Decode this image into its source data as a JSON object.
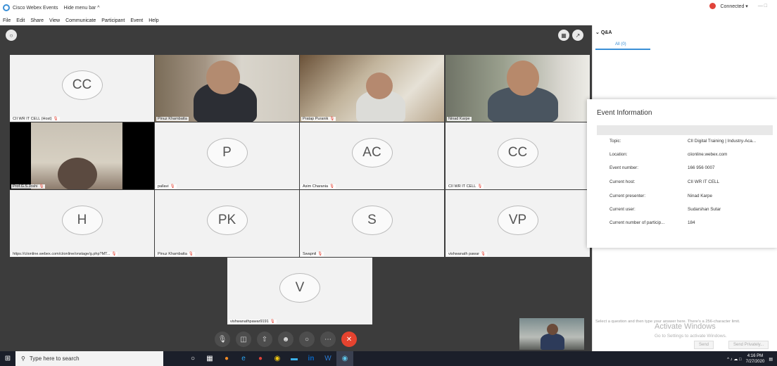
{
  "titlebar": {
    "app": "Cisco Webex Events",
    "hide_menu": "Hide menu bar ^",
    "status": "Connected ▾",
    "controls": "—  □"
  },
  "menu": [
    "File",
    "Edit",
    "Share",
    "View",
    "Communicate",
    "Participant",
    "Event",
    "Help"
  ],
  "tiles": [
    {
      "initials": "CC",
      "name": "CII WR IT CELL (Host)"
    },
    {
      "initials": "",
      "name": "Pinuz Khambatta"
    },
    {
      "initials": "",
      "name": "Pratap Puranik"
    },
    {
      "initials": "",
      "name": "Ninad Karpe"
    },
    {
      "initials": "",
      "name": "Prof.G.S.Joshi"
    },
    {
      "initials": "P",
      "name": "pallavi"
    },
    {
      "initials": "AC",
      "name": "Asim Charania"
    },
    {
      "initials": "CC",
      "name": "CII WR IT CELL"
    },
    {
      "initials": "H",
      "name": "https://ciionline.webex.com/ciionline/onstage/g.php?MT..."
    },
    {
      "initials": "PK",
      "name": "Pinuz Khambatta"
    },
    {
      "initials": "S",
      "name": "Swapnil"
    },
    {
      "initials": "VP",
      "name": "vishwanath pawar"
    },
    {
      "initials": "V",
      "name": "vishwanathpawar9191"
    }
  ],
  "qa": {
    "title": "Q&A",
    "tab": "All (0)",
    "input_placeholder": "Select a question and then type your answer here. There's a 256-character limit.",
    "send": "Send",
    "send_privately": "Send Privately..."
  },
  "event_info": {
    "title": "Event Information",
    "rows": [
      {
        "k": "Topic:",
        "v": "CII Digital Training | Industry-Aca..."
      },
      {
        "k": "Location:",
        "v": "ciionline.webex.com"
      },
      {
        "k": "Event number:",
        "v": "166 956 0007"
      },
      {
        "k": "Current host:",
        "v": "CII WR IT CELL"
      },
      {
        "k": "Current presenter:",
        "v": "Ninad Karpe"
      },
      {
        "k": "Current user:",
        "v": "Sudarshan Sutar"
      },
      {
        "k": "Current number of particip...",
        "v": "184"
      }
    ]
  },
  "watermark": {
    "line1": "Activate Windows",
    "line2": "Go to Settings to activate Windows."
  },
  "taskbar": {
    "search": "Type here to search",
    "time": "4:16 PM",
    "date": "7/27/2020"
  },
  "colors": {
    "stage": "#3c3c3c",
    "highlight": "#20b6e8",
    "end_call": "#e5432f"
  }
}
